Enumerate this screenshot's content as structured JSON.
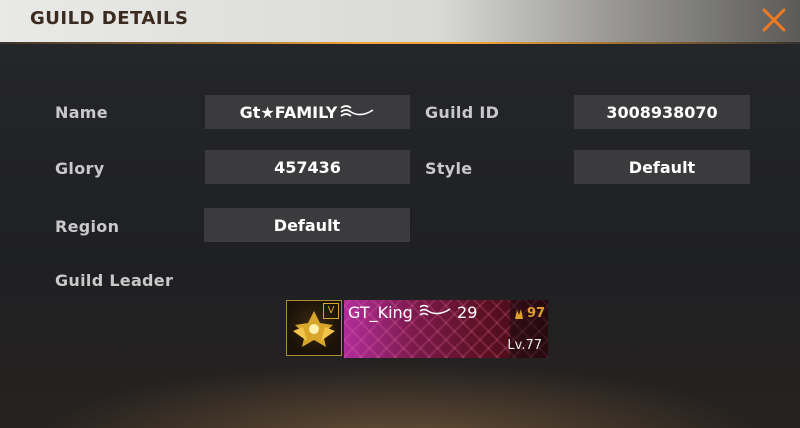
{
  "header": {
    "title": "GUILD DETAILS",
    "close_icon": "close-x-icon",
    "accent_color": "#f0a236"
  },
  "fields": {
    "name_label": "Name",
    "name_value": "Gt★FAMILY",
    "guild_id_label": "Guild ID",
    "guild_id_value": "3008938070",
    "glory_label": "Glory",
    "glory_value": "457436",
    "style_label": "Style",
    "style_value": "Default",
    "region_label": "Region",
    "region_value": "Default",
    "leader_label": "Guild Leader"
  },
  "leader": {
    "name": "GT_King",
    "tag": "29",
    "rank_icon": "rank-icon",
    "rank_value": "97",
    "level": "Lv.77",
    "avatar_badge": "V"
  }
}
